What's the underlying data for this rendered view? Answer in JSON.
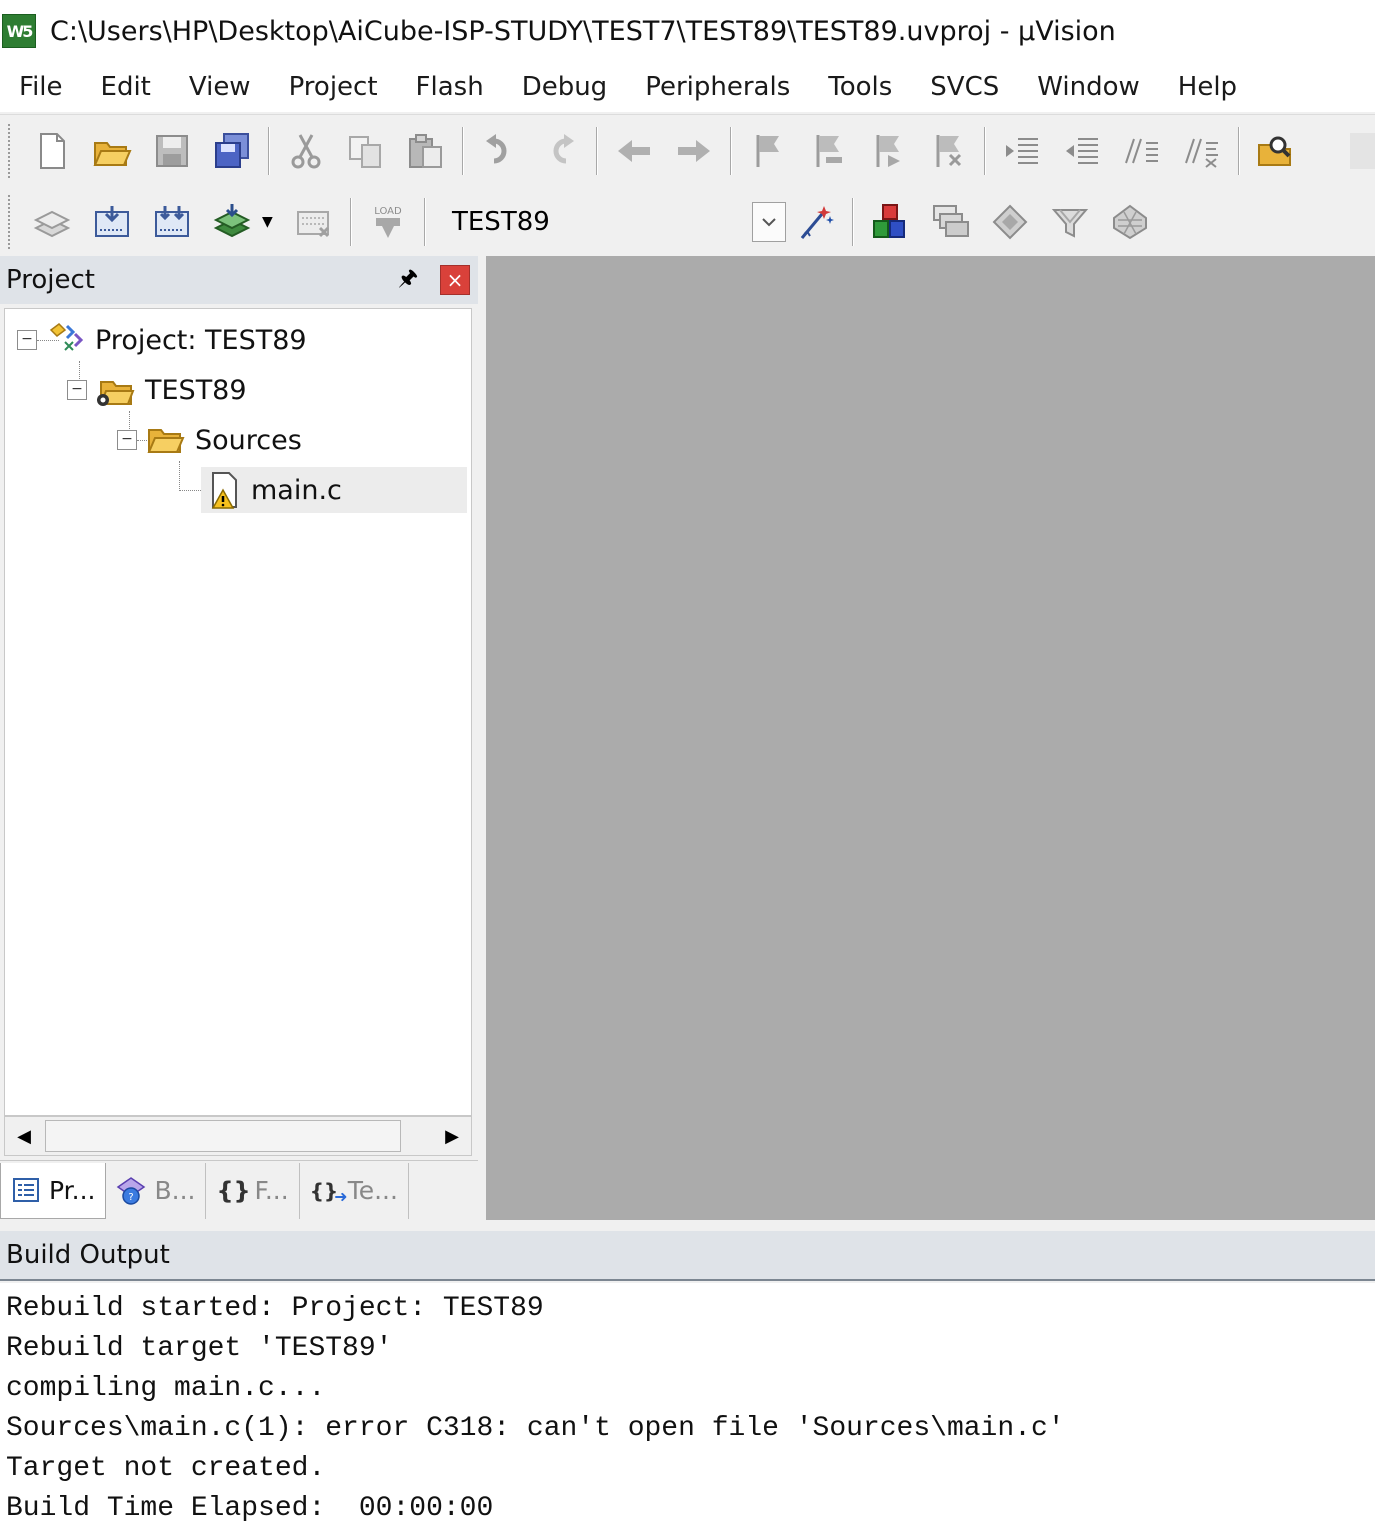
{
  "window": {
    "title": "C:\\Users\\HP\\Desktop\\AiCube-ISP-STUDY\\TEST7\\TEST89\\TEST89.uvproj - µVision",
    "app_icon_text": "W5"
  },
  "menu": [
    "File",
    "Edit",
    "View",
    "Project",
    "Flash",
    "Debug",
    "Peripherals",
    "Tools",
    "SVCS",
    "Window",
    "Help"
  ],
  "toolbar2": {
    "target": "TEST89",
    "load_text": "LOAD"
  },
  "project_panel": {
    "title": "Project",
    "pin_glyph": "🖈",
    "close_glyph": "×",
    "tree": {
      "root": "Project: TEST89",
      "target": "TEST89",
      "group": "Sources",
      "file": "main.c"
    },
    "tabs": [
      "Pr...",
      "B...",
      "F...",
      "Te..."
    ],
    "tab_glyphs": [
      "{}",
      "{}"
    ]
  },
  "build_output": {
    "title": "Build Output",
    "lines": [
      "Rebuild started: Project: TEST89",
      "Rebuild target 'TEST89'",
      "compiling main.c...",
      "Sources\\main.c(1): error C318: can't open file 'Sources\\main.c'",
      "Target not created.",
      "Build Time Elapsed:  00:00:00"
    ]
  },
  "colors": {
    "editor_bg": "#ababab",
    "panel_header": "#dfe3e8",
    "close_red": "#d9413a",
    "app_icon_green": "#2e7d32"
  }
}
